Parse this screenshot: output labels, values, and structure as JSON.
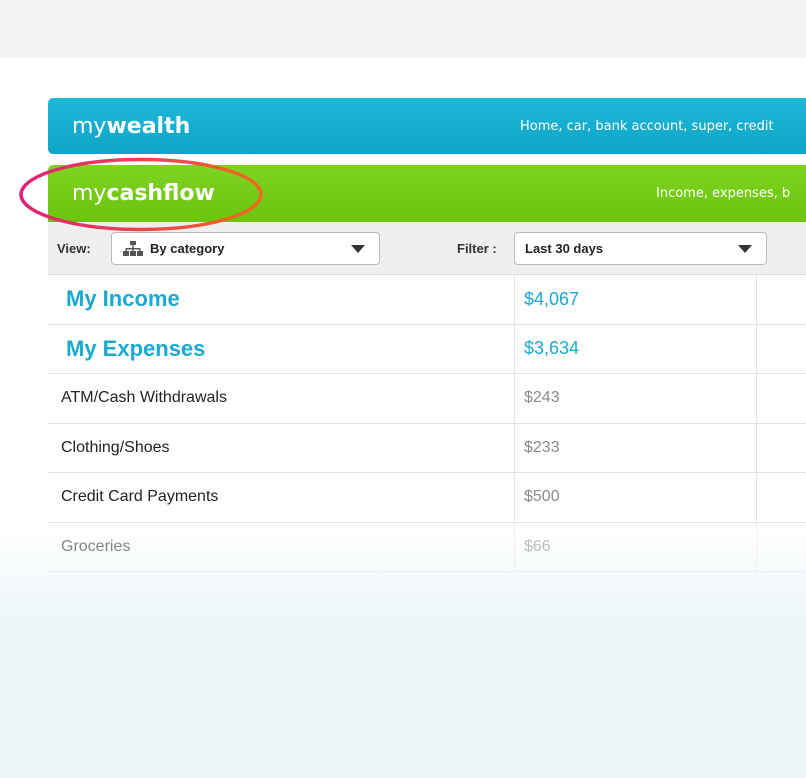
{
  "colors": {
    "wealth_bar": "#0ea5c8",
    "cashflow_bar": "#6cc40f",
    "heading_blue": "#19a9d3",
    "annotation_stroke_start": "#e0207a",
    "annotation_stroke_end": "#f26a1b"
  },
  "mywealth": {
    "prefix": "my",
    "name": "wealth",
    "tagline": "Home, car, bank account, super, credit"
  },
  "mycashflow": {
    "prefix": "my",
    "name": "cashflow",
    "tagline": "Income, expenses, b"
  },
  "toolbar": {
    "view_label": "View:",
    "view_icon": "hierarchy-icon",
    "view_value": "By category",
    "filter_label": "Filter :",
    "filter_value": "Last 30 days"
  },
  "table": {
    "rows": [
      {
        "label": "My Income",
        "amount": "$4,067"
      },
      {
        "label": "My Expenses",
        "amount": "$3,634"
      },
      {
        "label": "ATM/Cash Withdrawals",
        "amount": "$243"
      },
      {
        "label": "Clothing/Shoes",
        "amount": "$233"
      },
      {
        "label": "Credit Card Payments",
        "amount": "$500"
      },
      {
        "label": "Groceries",
        "amount": "$66"
      }
    ]
  }
}
